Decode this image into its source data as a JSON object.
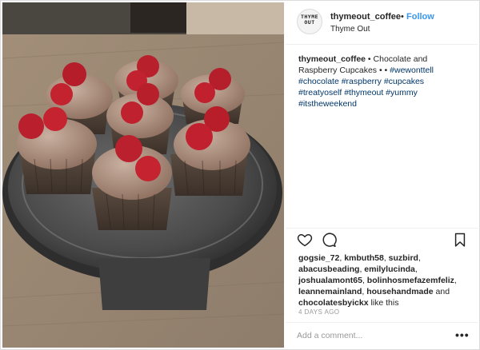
{
  "post": {
    "image_alt": "cupcakes-photo",
    "header": {
      "username": "thymeout_coffee",
      "separator": "•",
      "follow_label": "Follow",
      "location": "Thyme Out",
      "avatar_text_line1": "THYME",
      "avatar_text_line2": "OUT"
    },
    "caption": {
      "username": "thymeout_coffee",
      "text": " • Chocolate and Raspberry Cupcakes • • ",
      "hashtags": [
        "#wewonttell",
        "#chocolate",
        "#raspberry",
        "#cupcakes",
        "#treatyoself",
        "#thymeout",
        "#yummy",
        "#itstheweekend"
      ]
    },
    "actions": {
      "like_icon": "heart-icon",
      "comment_icon": "comment-icon",
      "save_icon": "bookmark-icon"
    },
    "likes": {
      "users": [
        "gogsie_72",
        "kmbuth58",
        "suzbird",
        "abacusbeading",
        "emilylucinda",
        "joshualamont65",
        "bolinhosmefazemfeliz",
        "leannemainland",
        "househandmade"
      ],
      "and_text": " and ",
      "last_user": "chocolatesbyickx",
      "suffix": " like this"
    },
    "timestamp": "4 DAYS AGO",
    "comment_placeholder": "Add a comment...",
    "more_label": "•••",
    "colors": {
      "follow": "#3897f0",
      "hashtag": "#003569",
      "text": "#262626",
      "muted": "#999999",
      "border": "#efefef"
    }
  }
}
